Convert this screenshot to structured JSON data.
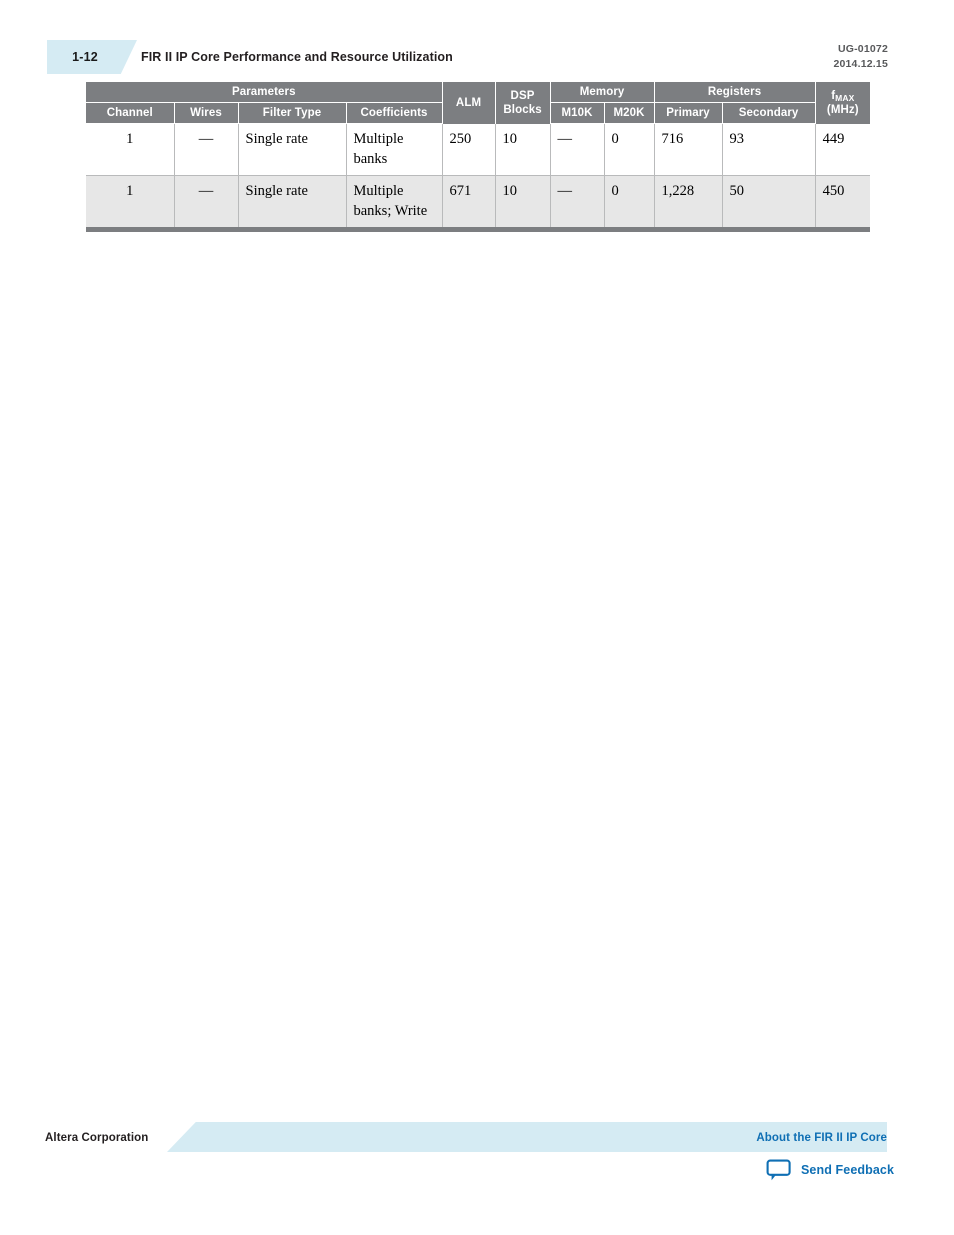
{
  "header": {
    "page_number": "1-12",
    "title": "FIR II IP Core Performance and Resource Utilization",
    "doc_id": "UG-01072",
    "doc_date": "2014.12.15"
  },
  "table": {
    "group_headers": {
      "parameters": "Parameters",
      "alm": "ALM",
      "dsp_blocks": "DSP\nBlocks",
      "dsp_blocks_line1": "DSP",
      "dsp_blocks_line2": "Blocks",
      "memory": "Memory",
      "registers": "Registers",
      "fmax_base": "f",
      "fmax_sub": "MAX",
      "fmax_unit": "(MHz)"
    },
    "sub_headers": {
      "channel": "Channel",
      "wires": "Wires",
      "filter_type": "Filter Type",
      "coefficients": "Coefficients",
      "m10k": "M10K",
      "m20k": "M20K",
      "primary": "Primary",
      "secondary": "Secondary"
    },
    "rows": [
      {
        "channel": "1",
        "wires": "—",
        "filter_type": "Single rate",
        "coefficients": "Multiple banks",
        "alm": "250",
        "dsp_blocks": "10",
        "m10k": "—",
        "m20k": "0",
        "primary": "716",
        "secondary": "93",
        "fmax": "449"
      },
      {
        "channel": "1",
        "wires": "—",
        "filter_type": "Single rate",
        "coefficients": "Multiple banks; Write",
        "alm": "671",
        "dsp_blocks": "10",
        "m10k": "—",
        "m20k": "0",
        "primary": "1,228",
        "secondary": "50",
        "fmax": "450"
      }
    ]
  },
  "footer": {
    "corporation": "Altera Corporation",
    "about_link": "About the FIR II IP Core",
    "feedback_label": "Send Feedback"
  },
  "colors": {
    "accent_blue": "#0f6fb4",
    "tab_blue": "#d5ebf3",
    "header_gray": "#7c7e81",
    "row_alt_gray": "#e7e7e7"
  }
}
